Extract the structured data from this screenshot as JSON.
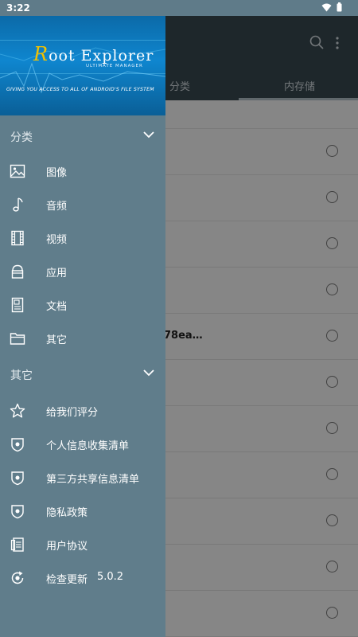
{
  "status_bar": {
    "time": "3:22"
  },
  "drawer": {
    "banner": {
      "logo_first": "R",
      "logo_rest": "oot Explorer",
      "logo_sub": "ULTIMATE MANAGER",
      "tagline": "GIVING YOU ACCESS TO ALL OF ANDROID'S FILE SYSTEM"
    },
    "section_categories": {
      "label": "分类"
    },
    "categories": [
      {
        "label": "图像",
        "icon": "image-icon"
      },
      {
        "label": "音频",
        "icon": "music-note-icon"
      },
      {
        "label": "视频",
        "icon": "film-icon"
      },
      {
        "label": "应用",
        "icon": "app-package-icon"
      },
      {
        "label": "文档",
        "icon": "document-icon"
      },
      {
        "label": "其它",
        "icon": "folder-icon"
      }
    ],
    "section_other": {
      "label": "其它"
    },
    "other": [
      {
        "label": "给我们评分",
        "icon": "star-icon"
      },
      {
        "label": "个人信息收集清单",
        "icon": "shield-icon"
      },
      {
        "label": "第三方共享信息清单",
        "icon": "shield-icon"
      },
      {
        "label": "隐私政策",
        "icon": "shield-icon"
      },
      {
        "label": "用户协议",
        "icon": "agreement-icon"
      },
      {
        "label": "检查更新",
        "icon": "update-icon",
        "version": "5.0.2"
      }
    ]
  },
  "background": {
    "tabs": {
      "categories": "分类",
      "storage": "内存储"
    },
    "row_text": "78ea…"
  },
  "colors": {
    "drawer": "#607d8b",
    "toolbar": "#37474f",
    "banner": "#0f86cf"
  }
}
